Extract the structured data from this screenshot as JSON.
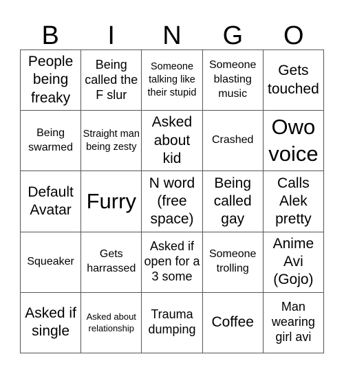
{
  "header": {
    "letters": [
      "B",
      "I",
      "N",
      "G",
      "O"
    ]
  },
  "card": {
    "rows": [
      [
        {
          "text": "People being freaky"
        },
        {
          "text": "Being called the F slur"
        },
        {
          "text": "Someone talking like their stupid"
        },
        {
          "text": "Someone blasting music"
        },
        {
          "text": "Gets touched"
        }
      ],
      [
        {
          "text": "Being swarmed"
        },
        {
          "text": "Straight man being zesty"
        },
        {
          "text": "Asked about kid"
        },
        {
          "text": "Crashed"
        },
        {
          "text": "Owo voice"
        }
      ],
      [
        {
          "text": "Default Avatar"
        },
        {
          "text": "Furry"
        },
        {
          "text": "N word (free space)"
        },
        {
          "text": "Being called gay"
        },
        {
          "text": "Calls Alek pretty"
        }
      ],
      [
        {
          "text": "Squeaker"
        },
        {
          "text": "Gets harrassed"
        },
        {
          "text": "Asked if open for a 3 some"
        },
        {
          "text": "Someone trolling"
        },
        {
          "text": "Anime Avi (Gojo)"
        }
      ],
      [
        {
          "text": "Asked if single"
        },
        {
          "text": "Asked about relationship"
        },
        {
          "text": "Trauma dumping"
        },
        {
          "text": "Coffee"
        },
        {
          "text": "Man wearing girl avi"
        }
      ]
    ]
  }
}
